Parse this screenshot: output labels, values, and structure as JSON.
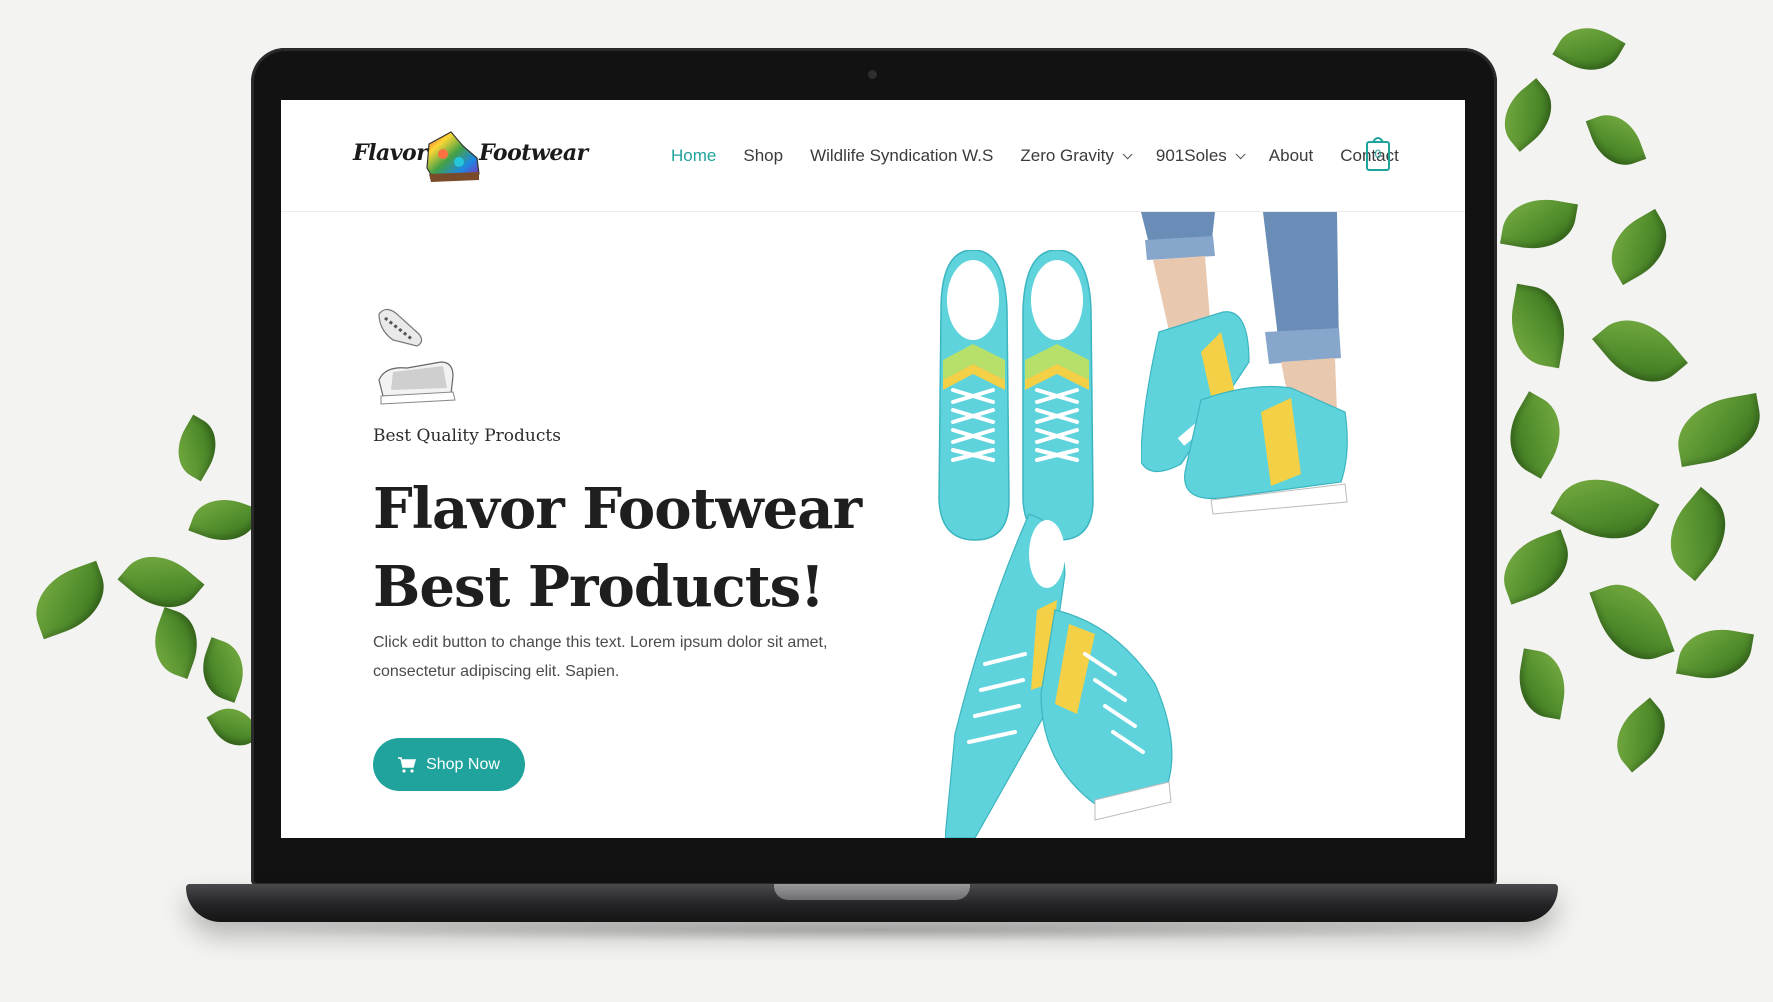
{
  "brand": {
    "logo_left": "Flavor",
    "logo_right": "Footwear"
  },
  "nav": {
    "items": [
      {
        "label": "Home",
        "active": true,
        "dropdown": false
      },
      {
        "label": "Shop",
        "active": false,
        "dropdown": false
      },
      {
        "label": "Wildlife Syndication W.S",
        "active": false,
        "dropdown": false
      },
      {
        "label": "Zero Gravity",
        "active": false,
        "dropdown": true
      },
      {
        "label": "901Soles",
        "active": false,
        "dropdown": true
      },
      {
        "label": "About",
        "active": false,
        "dropdown": false
      },
      {
        "label": "Contact",
        "active": false,
        "dropdown": false
      }
    ],
    "cart_count": "0"
  },
  "hero": {
    "eyebrow": "Best Quality Products",
    "headline": "Flavor Footwear Best Products!",
    "body": "Click edit button to change this text. Lorem ipsum dolor sit amet, consectetur adipiscing elit. Sapien.",
    "cta_label": "Shop Now"
  },
  "colors": {
    "accent": "#1fa39c",
    "shoe_teal": "#5fd3dc",
    "text_dark": "#1e1e1e"
  },
  "icons": [
    "cart-icon",
    "shopping-cart-icon",
    "chevron-down-icon"
  ]
}
